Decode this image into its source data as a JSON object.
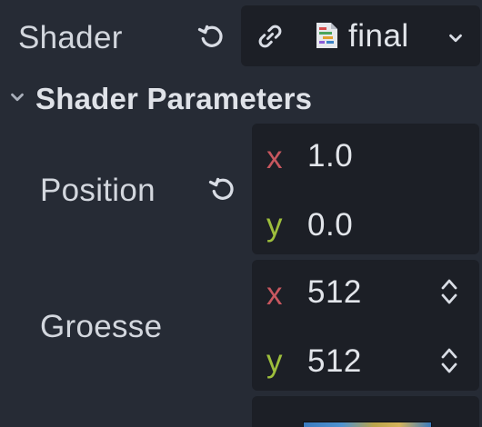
{
  "shader": {
    "label": "Shader",
    "revert_icon": "revert-icon",
    "link_icon": "link-icon",
    "resource": {
      "name": "final",
      "file_icon": "shader-file-icon",
      "dropdown_icon": "chevron-down-icon"
    }
  },
  "section": {
    "title": "Shader Parameters",
    "collapse_icon": "chevron-down-icon"
  },
  "params": {
    "position": {
      "label": "Position",
      "revert_icon": "revert-icon",
      "x_label": "x",
      "x_value": "1.0",
      "y_label": "y",
      "y_value": "0.0"
    },
    "groesse": {
      "label": "Groesse",
      "x_label": "x",
      "x_value": "512",
      "y_label": "y",
      "y_value": "512",
      "spinner_icon": "up-down-spinner-icon"
    }
  },
  "colors": {
    "background": "#262b35",
    "field": "#1c1f26",
    "axis_x": "#c8575f",
    "axis_y": "#9ebf3c"
  }
}
